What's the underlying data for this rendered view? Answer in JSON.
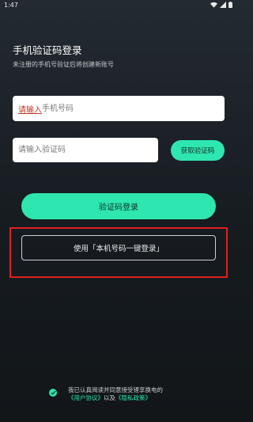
{
  "status_bar": {
    "time": "1:47",
    "icons": [
      "wifi-icon",
      "signal-icon",
      "battery-icon"
    ]
  },
  "header": {
    "title": "手机验证码登录",
    "subtitle": "未注册的手机号验证后将创建新账号"
  },
  "form": {
    "phone_placeholder": "请输入手机号码",
    "phone_ime_text": "请输入",
    "code_placeholder": "请输入验证码",
    "get_code_label": "获取验证码",
    "login_label": "验证码登录",
    "one_click_label": "使用「本机号码一键登录」"
  },
  "agreement": {
    "checked": true,
    "line1": "我已认真阅读并同意接受锂享换电的",
    "user_agreement": "《用户协议》",
    "connector": "以及",
    "privacy_policy": "《隐私政策》"
  },
  "colors": {
    "accent": "#2ee6b0",
    "background": "#1b2127",
    "highlight": "#e02020"
  }
}
